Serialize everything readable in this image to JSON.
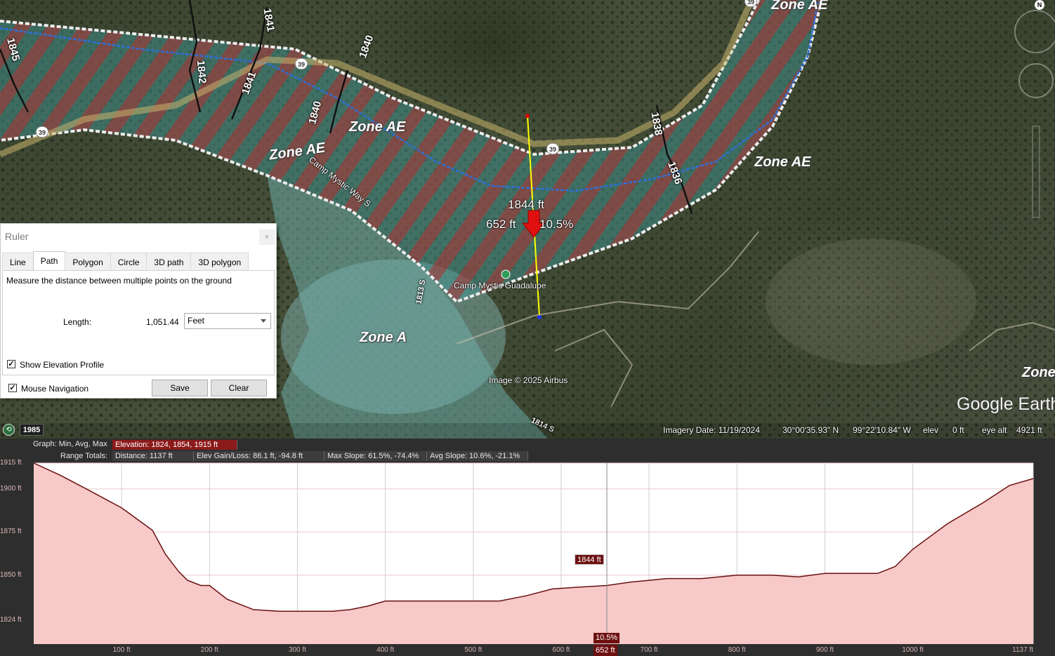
{
  "map": {
    "zone_labels": [
      "Zone AE",
      "Zone AE",
      "Zone AE",
      "Zone A",
      "Zone",
      "Zone AE"
    ],
    "contour_labels": [
      "1845",
      "1842",
      "1841",
      "1840",
      "1840",
      "1838",
      "1836",
      "1841",
      "1813 S",
      "1814 S"
    ],
    "route_shield": "39",
    "road_label": "Camp Mystic Way S",
    "place_label": "Camp Mystic Guadalupe",
    "place_icon": "campground-icon",
    "measure_elevation": "1844 ft",
    "measure_distance": "652 ft",
    "measure_slope": "10.5%",
    "attribution": "Image © 2025 Airbus",
    "logo": "Google Earth",
    "compass": "N"
  },
  "status": {
    "year": "1985",
    "imagery_date": "Imagery Date: 11/19/2024",
    "lat": "30°00'35.93\" N",
    "lon": "99°22'10.84\" W",
    "elev_label": "elev",
    "elev_value": "0 ft",
    "eye_alt_label": "eye alt",
    "eye_alt_value": "4921 ft"
  },
  "ruler": {
    "title": "Ruler",
    "close": "×",
    "tabs": [
      "Line",
      "Path",
      "Polygon",
      "Circle",
      "3D path",
      "3D polygon"
    ],
    "active_tab": "Path",
    "description": "Measure the distance between multiple points on the ground",
    "length_label": "Length:",
    "length_value": "1,051.44",
    "unit": "Feet",
    "show_elevation_label": "Show Elevation Profile",
    "show_elevation_checked": true,
    "mouse_nav_label": "Mouse Navigation",
    "mouse_nav_checked": true,
    "save_label": "Save",
    "clear_label": "Clear"
  },
  "profile": {
    "graph_label": "Graph: Min, Avg, Max",
    "elevation": "Elevation: 1824, 1854, 1915 ft",
    "range_label": "Range Totals:",
    "distance": "Distance: 1137 ft",
    "gain_loss": "Elev Gain/Loss: 86.1 ft, -94.8 ft",
    "max_slope": "Max Slope: 61.5%, -74.4%",
    "avg_slope": "Avg Slope: 10.6%, -21.1%",
    "marker_elevation": "1844 ft",
    "marker_slope": "10.5%",
    "marker_x": "652 ft",
    "colors": {
      "fill": "#f7c9c9",
      "line": "#6b0f0f",
      "header_highlight": "#8b1a1a"
    }
  },
  "chart_data": {
    "type": "area",
    "title": "",
    "xlabel": "",
    "ylabel": "",
    "xlim": [
      0,
      1137
    ],
    "ylim": [
      1810,
      1915
    ],
    "y_ticks": [
      1824,
      1850,
      1875,
      1900,
      1915
    ],
    "y_tick_labels": [
      "1824 ft",
      "1850 ft",
      "1875 ft",
      "1900 ft",
      "1915 ft"
    ],
    "x_ticks": [
      100,
      200,
      300,
      400,
      500,
      600,
      700,
      800,
      900,
      1000,
      1137
    ],
    "x_tick_labels": [
      "100 ft",
      "200 ft",
      "300 ft",
      "400 ft",
      "500 ft",
      "600 ft",
      "700 ft",
      "800 ft",
      "900 ft",
      "1000 ft",
      "1137 ft"
    ],
    "series": [
      {
        "x": [
          0,
          30,
          60,
          100,
          135,
          150,
          165,
          175,
          190,
          200,
          220,
          250,
          280,
          300,
          340,
          360,
          380,
          400,
          420,
          460,
          500,
          530,
          560,
          590,
          620,
          652,
          680,
          700,
          720,
          760,
          800,
          840,
          870,
          900,
          960,
          980,
          1000,
          1040,
          1080,
          1110,
          1137
        ],
        "y": [
          1915,
          1908,
          1900,
          1889,
          1876,
          1862,
          1852,
          1847,
          1844,
          1844,
          1836,
          1830,
          1829,
          1829,
          1829,
          1830,
          1832,
          1835,
          1835,
          1835,
          1835,
          1835,
          1838,
          1842,
          1843,
          1844,
          1846,
          1847,
          1848,
          1848,
          1850,
          1850,
          1849,
          1851,
          1851,
          1855,
          1865,
          1880,
          1892,
          1902,
          1906
        ]
      }
    ],
    "cursor": {
      "x": 652,
      "y": 1844,
      "slope": "10.5%"
    },
    "grid": true
  }
}
